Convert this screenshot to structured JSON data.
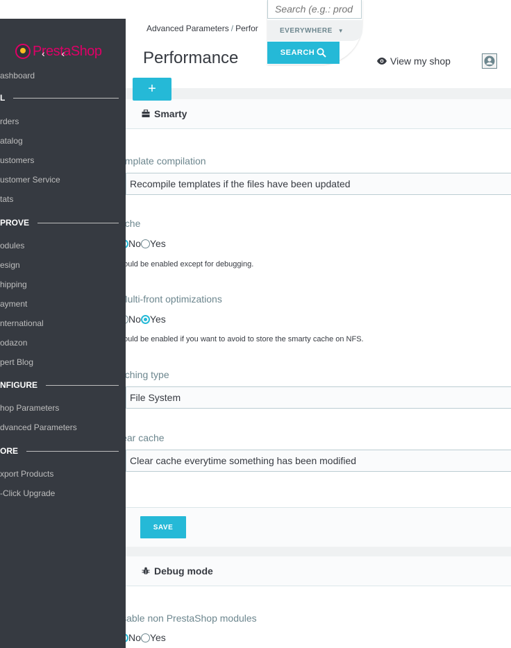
{
  "sidebar": {
    "brand_first": "Presta",
    "brand_second": "Shop",
    "collapse_glyph": "‹ ‹",
    "items": [
      {
        "label": "ashboard",
        "type": "item"
      },
      {
        "label": "L",
        "type": "section"
      },
      {
        "label": "rders",
        "type": "item"
      },
      {
        "label": "atalog",
        "type": "item"
      },
      {
        "label": "ustomers",
        "type": "item"
      },
      {
        "label": "ustomer Service",
        "type": "item"
      },
      {
        "label": "tats",
        "type": "item"
      },
      {
        "label": "PROVE",
        "type": "section"
      },
      {
        "label": "odules",
        "type": "item"
      },
      {
        "label": "esign",
        "type": "item"
      },
      {
        "label": "hipping",
        "type": "item"
      },
      {
        "label": "ayment",
        "type": "item"
      },
      {
        "label": "nternational",
        "type": "item"
      },
      {
        "label": "odazon",
        "type": "item"
      },
      {
        "label": "pert Blog",
        "type": "item"
      },
      {
        "label": "NFIGURE",
        "type": "section"
      },
      {
        "label": "hop Parameters",
        "type": "item"
      },
      {
        "label": "dvanced Parameters",
        "type": "item"
      },
      {
        "label": "ORE",
        "type": "section"
      },
      {
        "label": "xport Products",
        "type": "item"
      },
      {
        "label": "-Click Upgrade",
        "type": "item"
      }
    ]
  },
  "header": {
    "breadcrumb_parent": "Advanced Parameters",
    "breadcrumb_sep": "/",
    "breadcrumb_current": "Perfor",
    "title": "Performance",
    "view_shop": "View my shop",
    "add_button": "+"
  },
  "search": {
    "placeholder": "Search (e.g.: prod",
    "scope": "EVERYWHERE",
    "button": "SEARCH"
  },
  "smarty": {
    "heading": "Smarty",
    "template_label": "emplate compilation",
    "template_value": "Recompile templates if the files have been updated",
    "cache_label": "ache",
    "cache_no": "No",
    "cache_yes": "Yes",
    "cache_selected": "No",
    "cache_help": "hould be enabled except for debugging.",
    "multifront_label": "Multi-front optimizations",
    "multifront_no": "No",
    "multifront_yes": "Yes",
    "multifront_selected": "Yes",
    "multifront_help": "hould be enabled if you want to avoid to store the smarty cache on NFS.",
    "caching_type_label": "aching type",
    "caching_type_value": "File System",
    "clear_cache_label": "lear cache",
    "clear_cache_value": "Clear cache everytime something has been modified",
    "save": "SAVE"
  },
  "debug": {
    "heading": "Debug mode",
    "disable_label": "isable non PrestaShop modules",
    "disable_no": "No",
    "disable_yes": "Yes",
    "disable_selected": "No"
  },
  "colors": {
    "sidebar_bg": "#363a41",
    "accent": "#25b9d7",
    "brand": "#df0067"
  },
  "icons": {
    "view_shop": "eye-icon",
    "account": "user-icon",
    "smarty": "briefcase-icon",
    "debug": "bug-icon",
    "search": "search-icon"
  }
}
